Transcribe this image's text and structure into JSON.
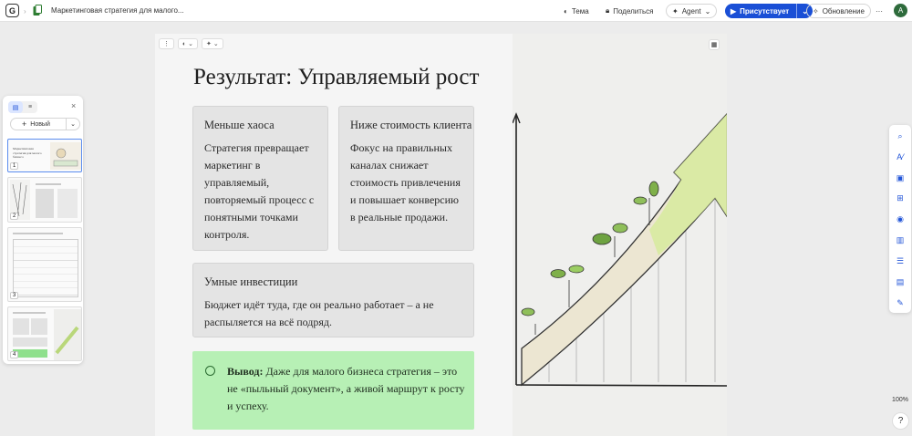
{
  "topbar": {
    "logo": "G",
    "doc_title": "Маркетинговая стратегия для малого...",
    "theme_label": "Тема",
    "share_label": "Поделиться",
    "agent_label": "Agent",
    "present_label": "Присутствует",
    "update_label": "Обновление",
    "more_label": "···",
    "avatar_initial": "A"
  },
  "thumbnails": {
    "new_label": "Новый",
    "items": [
      {
        "num": "1",
        "title": "Маркетинговая стратегия для малого бизнеса"
      },
      {
        "num": "2",
        "title": ""
      },
      {
        "num": "3",
        "title": ""
      },
      {
        "num": "4",
        "title": ""
      }
    ]
  },
  "slide": {
    "title": "Результат: Управляемый рост",
    "cards": [
      {
        "heading": "Меньше хаоса",
        "body": "Стратегия превращает маркетинг в управляемый, повторяемый процесс с понятными точками контроля."
      },
      {
        "heading": "Ниже стоимость клиента",
        "body": "Фокус на правильных каналах снижает стоимость привлечения и повышает конверсию в реальные продажи."
      },
      {
        "heading": "Умные инвестиции",
        "body": "Бюджет идёт туда, где он реально работает – а не распыляется на всё подряд."
      }
    ],
    "conclusion_bold": "Вывод:",
    "conclusion_text": " Даже для малого бизнеса стратегия – это не «пыльный документ», а живой маршрут к росту и успеху."
  },
  "zoom_level": "100%",
  "help_label": "?",
  "colors": {
    "accent": "#1a4fd6",
    "conclusion_bg": "#b7f0b5",
    "card_bg": "#e4e4e4"
  }
}
